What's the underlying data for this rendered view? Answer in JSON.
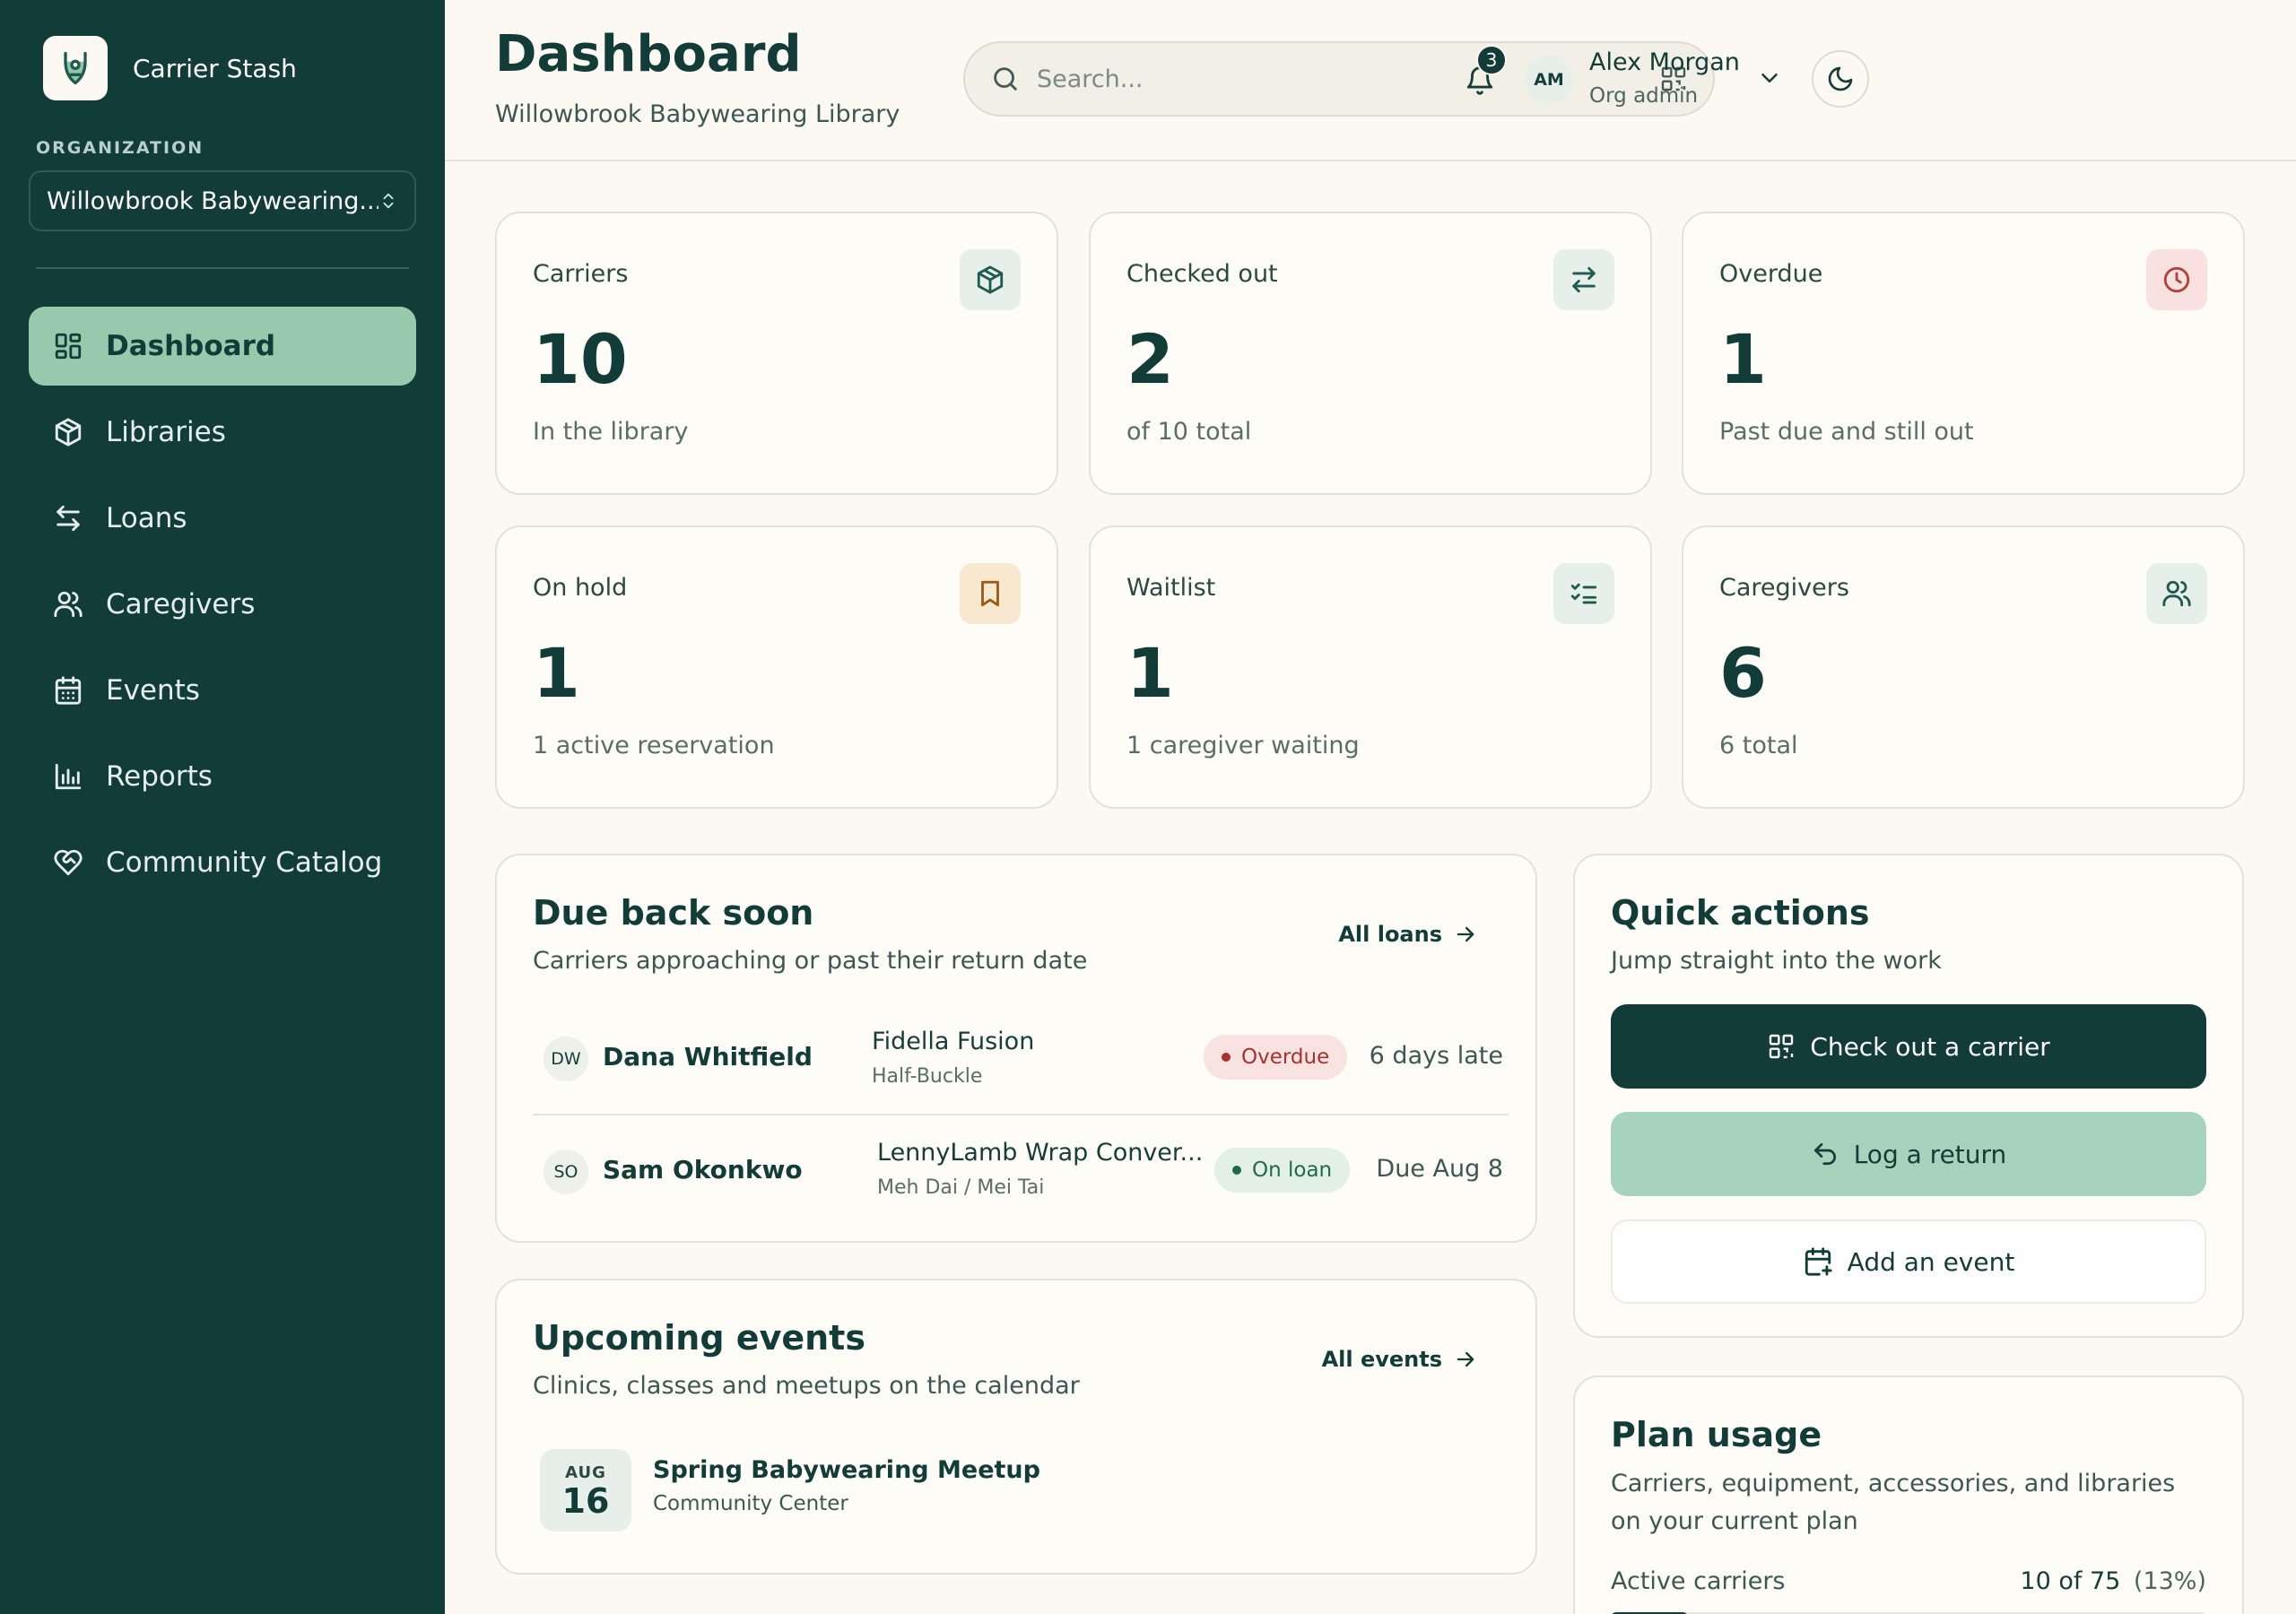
{
  "app": {
    "name": "Carrier Stash"
  },
  "sidebar": {
    "org_label": "ORGANIZATION",
    "org_selected": "Willowbrook Babywearing...",
    "items": [
      {
        "label": "Dashboard",
        "icon": "layout-grid-icon",
        "active": true
      },
      {
        "label": "Libraries",
        "icon": "box-icon"
      },
      {
        "label": "Loans",
        "icon": "arrows-swap-icon"
      },
      {
        "label": "Caregivers",
        "icon": "users-icon"
      },
      {
        "label": "Events",
        "icon": "calendar-icon"
      },
      {
        "label": "Reports",
        "icon": "bar-chart-icon"
      },
      {
        "label": "Community Catalog",
        "icon": "heart-handshake-icon"
      }
    ]
  },
  "header": {
    "title": "Dashboard",
    "subtitle": "Willowbrook Babywearing Library",
    "search_placeholder": "Search...",
    "notifications_count": "3",
    "user": {
      "initials": "AM",
      "name": "Alex Morgan",
      "role": "Org admin"
    }
  },
  "stats": [
    {
      "label": "Carriers",
      "value": "10",
      "sub": "In the library",
      "icon": "box-icon",
      "icon_bg": "#e6efe9",
      "icon_color": "#1f5a50"
    },
    {
      "label": "Checked out",
      "value": "2",
      "sub": "of 10 total",
      "icon": "arrows-swap-icon",
      "icon_bg": "#e6efe9",
      "icon_color": "#1f5a50"
    },
    {
      "label": "Overdue",
      "value": "1",
      "sub": "Past due and still out",
      "icon": "clock-icon",
      "icon_bg": "#f8e1df",
      "icon_color": "#b3403a"
    },
    {
      "label": "On hold",
      "value": "1",
      "sub": "1 active reservation",
      "icon": "bookmark-icon",
      "icon_bg": "#f8e8cf",
      "icon_color": "#9a5a12"
    },
    {
      "label": "Waitlist",
      "value": "1",
      "sub": "1 caregiver waiting",
      "icon": "list-checks-icon",
      "icon_bg": "#e6efe9",
      "icon_color": "#1f5a50"
    },
    {
      "label": "Caregivers",
      "value": "6",
      "sub": "6 total",
      "icon": "users-icon",
      "icon_bg": "#e6efe9",
      "icon_color": "#1f5a50"
    }
  ],
  "due_back": {
    "title": "Due back soon",
    "subtitle": "Carriers approaching or past their return date",
    "link": "All loans",
    "rows": [
      {
        "initials": "DW",
        "name": "Dana Whitfield",
        "carrier": "Fidella Fusion",
        "type": "Half-Buckle",
        "status": "Overdue",
        "when": "6 days late"
      },
      {
        "initials": "SO",
        "name": "Sam Okonkwo",
        "carrier": "LennyLamb Wrap Conver...",
        "type": "Meh Dai / Mei Tai",
        "status": "On loan",
        "when": "Due Aug 8"
      }
    ]
  },
  "events": {
    "title": "Upcoming events",
    "subtitle": "Clinics, classes and meetups on the calendar",
    "link": "All events",
    "items": [
      {
        "month": "AUG",
        "day": "16",
        "title": "Spring Babywearing Meetup",
        "place": "Community Center"
      }
    ]
  },
  "quick_actions": {
    "title": "Quick actions",
    "subtitle": "Jump straight into the work",
    "buttons": [
      {
        "label": "Check out a carrier",
        "icon": "qr-code-icon"
      },
      {
        "label": "Log a return",
        "icon": "undo-icon"
      },
      {
        "label": "Add an event",
        "icon": "calendar-plus-icon"
      }
    ]
  },
  "plan": {
    "title": "Plan usage",
    "subtitle": "Carriers, equipment, accessories, and libraries on your current plan",
    "label": "Active carriers",
    "value": "10 of 75",
    "percent_text": "(13%)",
    "fraction": 0.13
  }
}
